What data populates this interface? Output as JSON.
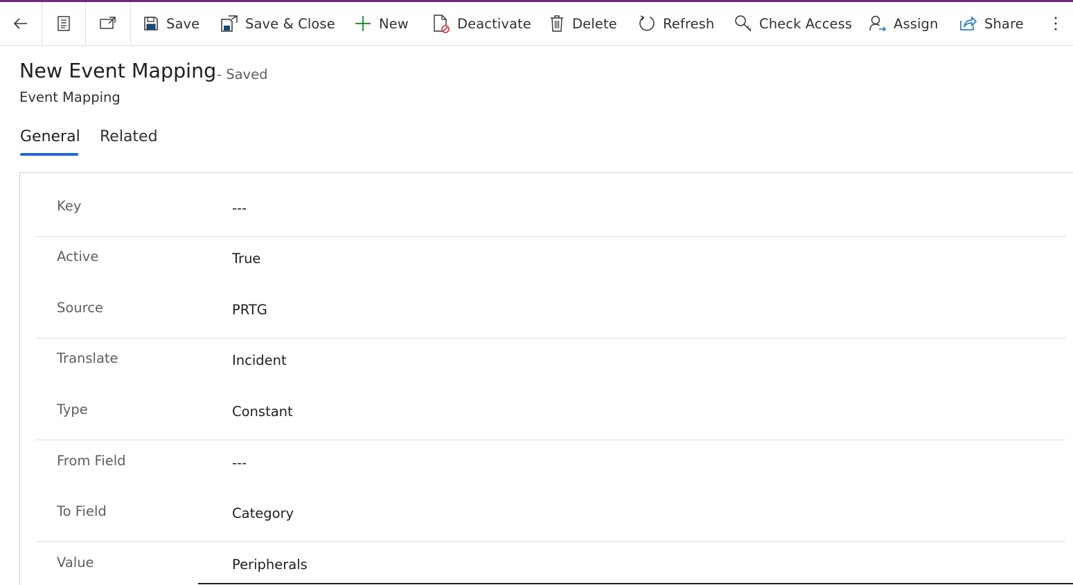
{
  "commandbar": {
    "back_icon": "back-arrow-icon",
    "form_icon": "form-selector-icon",
    "popout_icon": "open-in-new-window-icon",
    "items": [
      {
        "label": "Save",
        "icon": "save-icon"
      },
      {
        "label": "Save & Close",
        "icon": "save-and-close-icon"
      },
      {
        "label": "New",
        "icon": "plus-icon"
      },
      {
        "label": "Deactivate",
        "icon": "deactivate-icon"
      },
      {
        "label": "Delete",
        "icon": "trash-icon"
      },
      {
        "label": "Refresh",
        "icon": "refresh-icon"
      },
      {
        "label": "Check Access",
        "icon": "check-access-icon"
      },
      {
        "label": "Assign",
        "icon": "assign-icon"
      },
      {
        "label": "Share",
        "icon": "share-icon"
      }
    ],
    "more_icon": "more-vertical-icon"
  },
  "header": {
    "title": "New Event Mapping",
    "status": "- Saved",
    "entity": "Event Mapping"
  },
  "tabs": [
    {
      "label": "General",
      "active": true
    },
    {
      "label": "Related",
      "active": false
    }
  ],
  "form": {
    "fields": [
      {
        "label": "Key",
        "value": "---"
      },
      {
        "label": "Active",
        "value": "True"
      },
      {
        "label": "Source",
        "value": "PRTG"
      },
      {
        "label": "Translate",
        "value": "Incident"
      },
      {
        "label": "Type",
        "value": "Constant"
      },
      {
        "label": "From Field",
        "value": "---"
      },
      {
        "label": "To Field",
        "value": "Category"
      },
      {
        "label": "Value",
        "value": "Peripherals"
      }
    ]
  },
  "colors": {
    "brand_stripe": "#6e2a7a",
    "tab_accent": "#2266e3",
    "new_plus": "#107c10",
    "deactivate_badge": "#d13438",
    "share_blue": "#0f6cbd"
  }
}
